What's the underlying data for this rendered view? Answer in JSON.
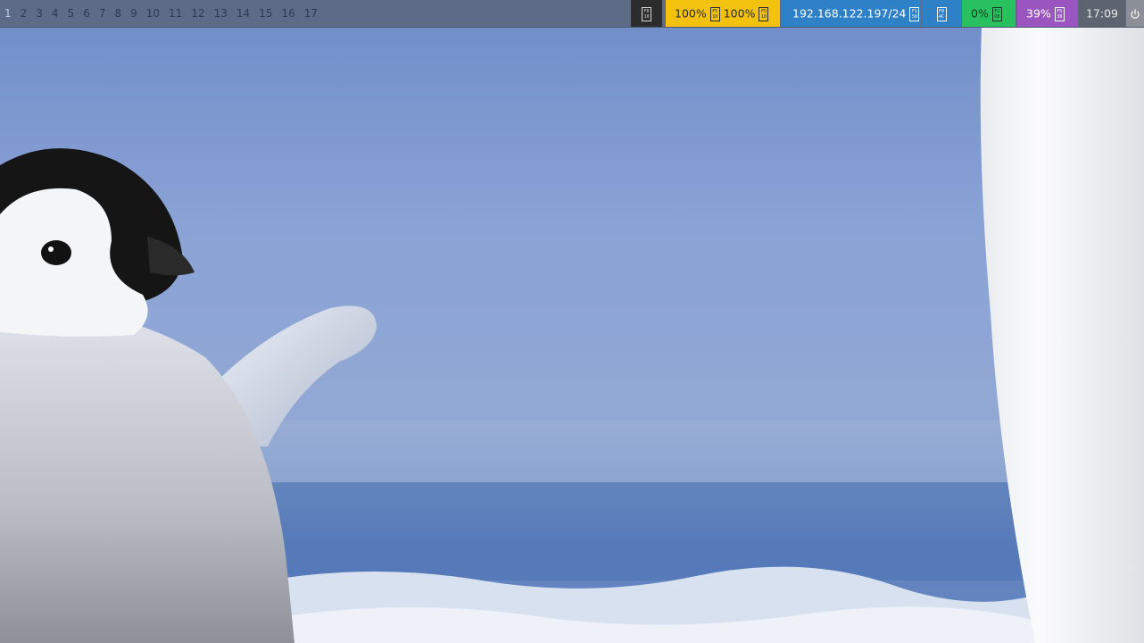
{
  "workspaces": [
    "1",
    "2",
    "3",
    "4",
    "5",
    "6",
    "7",
    "8",
    "9",
    "10",
    "11",
    "12",
    "13",
    "14",
    "15",
    "16",
    "17"
  ],
  "active_workspace": "1",
  "status": {
    "unknown_glyph": [
      "F0",
      "10"
    ],
    "volume_a": "100%",
    "volume_glyph_a": [
      "F5",
      "10"
    ],
    "volume_b": "100%",
    "volume_glyph_b": [
      "F5",
      "10"
    ],
    "network": "192.168.122.197/24",
    "network_glyph": [
      "F1",
      "50"
    ],
    "network2_glyph": [
      "F0",
      "4C"
    ],
    "cpu": "0%",
    "cpu_glyph": [
      "F2",
      "DB"
    ],
    "memory": "39%",
    "memory_glyph": [
      "F5",
      "38"
    ],
    "clock": "17:09",
    "power_icon": "power-icon"
  },
  "colors": {
    "bar_bg": "#5d6b86",
    "volume": "#f3c20e",
    "network": "#2e80c7",
    "cpu": "#29c160",
    "memory": "#9b55c0",
    "clock": "#5d6470",
    "power": "#8a8f98"
  },
  "wallpaper": "emperor-penguin-chick-on-ice"
}
